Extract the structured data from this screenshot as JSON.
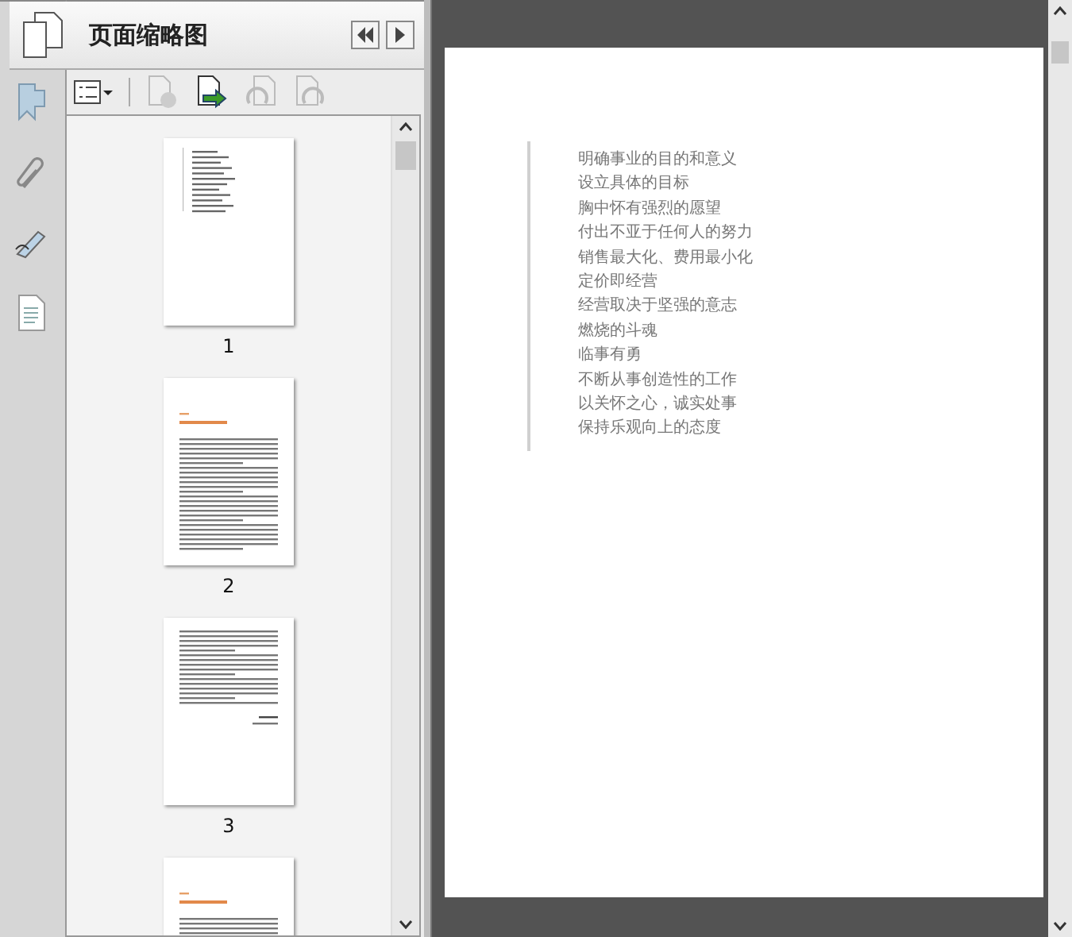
{
  "panel": {
    "title": "页面缩略图"
  },
  "thumbnails": [
    {
      "label": "1",
      "kind": "list"
    },
    {
      "label": "2",
      "kind": "chapter"
    },
    {
      "label": "3",
      "kind": "text"
    },
    {
      "kind": "chapter"
    }
  ],
  "document": {
    "lines": [
      "明确事业的目的和意义",
      "设立具体的目标",
      "胸中怀有强烈的愿望",
      "付出不亚于任何人的努力",
      "销售最大化、费用最小化",
      "定价即经营",
      "经营取决于坚强的意志",
      "燃烧的斗魂",
      "临事有勇",
      "不断从事创造性的工作",
      "以关怀之心，诚实处事",
      "保持乐观向上的态度"
    ]
  }
}
